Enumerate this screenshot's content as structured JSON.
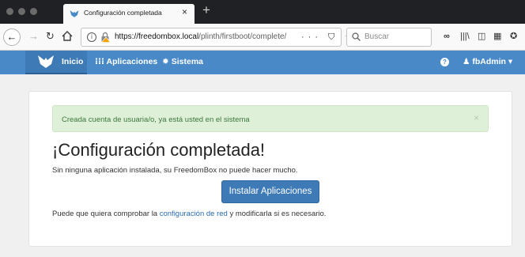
{
  "browser": {
    "tab_title": "Configuración completada",
    "tab_close": "×",
    "new_tab": "+",
    "url_host": "https://freedombox.local",
    "url_path": "/plinth/firstboot/complete/",
    "url_actions": "··· ⛉ ☆",
    "search_placeholder": "Buscar"
  },
  "site_nav": {
    "home_label": "Inicio",
    "apps_label": "Aplicaciones",
    "system_label": "Sistema",
    "user_label": "fbAdmin",
    "accent_color": "#4989c8"
  },
  "main": {
    "alert_text": "Creada cuenta de usuaria/o, ya está usted en el sistema",
    "alert_close": "×",
    "heading": "¡Configuración completada!",
    "paragraph1": "Sin ninguna aplicación instalada, su FreedomBox no puede hacer mucho.",
    "install_button": "Instalar Aplicaciones",
    "paragraph2_before": "Puede que quiera comprobar la ",
    "paragraph2_link": "configuración de red",
    "paragraph2_after": " y modificarla si es necesario."
  }
}
